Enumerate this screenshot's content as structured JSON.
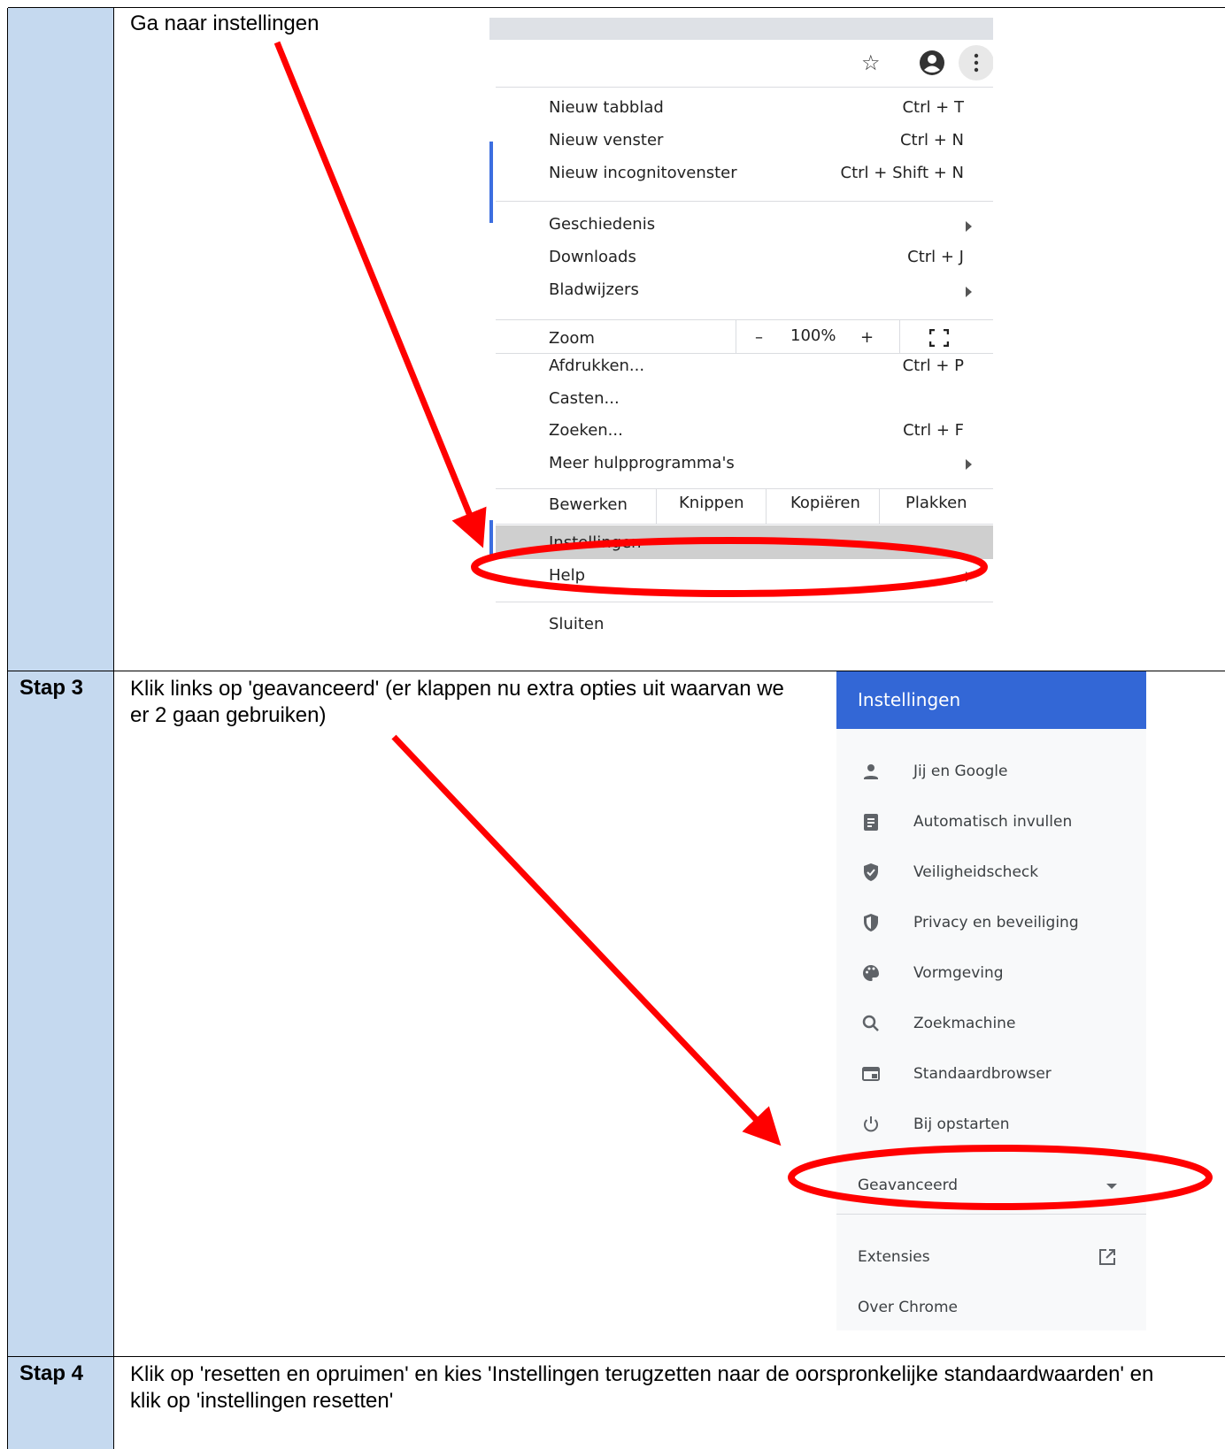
{
  "rows": [
    {
      "step": "",
      "instruction": "Ga naar instellingen"
    },
    {
      "step": "Stap 3",
      "instruction": "Klik links op 'geavanceerd' (er klappen nu extra opties uit waarvan we er 2 gaan gebruiken)"
    },
    {
      "step": "Stap 4",
      "instruction": "Klik op 'resetten en opruimen' en kies 'Instellingen terugzetten naar de oorspronkelijke standaardwaarden' en klik op 'instellingen resetten'"
    }
  ],
  "chrome_menu": {
    "toolbar_icons": [
      "star-icon",
      "account-icon",
      "more-vert-icon"
    ],
    "items": [
      {
        "label": "Nieuw tabblad",
        "shortcut": "Ctrl + T"
      },
      {
        "label": "Nieuw venster",
        "shortcut": "Ctrl + N"
      },
      {
        "label": "Nieuw incognitovenster",
        "shortcut": "Ctrl + Shift + N"
      },
      {
        "label": "Geschiedenis",
        "shortcut": ""
      },
      {
        "label": "Downloads",
        "shortcut": "Ctrl + J"
      },
      {
        "label": "Bladwijzers",
        "shortcut": ""
      },
      {
        "label": "Afdrukken...",
        "shortcut": "Ctrl + P"
      },
      {
        "label": "Casten...",
        "shortcut": ""
      },
      {
        "label": "Zoeken...",
        "shortcut": "Ctrl + F"
      },
      {
        "label": "Meer hulpprogramma's",
        "shortcut": ""
      },
      {
        "label": "Instellingen",
        "shortcut": ""
      },
      {
        "label": "Help",
        "shortcut": ""
      },
      {
        "label": "Sluiten",
        "shortcut": ""
      }
    ],
    "zoom": {
      "label": "Zoom",
      "minus": "–",
      "value": "100%",
      "plus": "+"
    },
    "edit": {
      "label": "Bewerken",
      "cut": "Knippen",
      "copy": "Kopiëren",
      "paste": "Plakken"
    }
  },
  "settings_panel": {
    "title": "Instellingen",
    "items": [
      {
        "label": "Jij en Google",
        "icon": "person-icon"
      },
      {
        "label": "Automatisch invullen",
        "icon": "clipboard-icon"
      },
      {
        "label": "Veiligheidscheck",
        "icon": "shield-check-icon"
      },
      {
        "label": "Privacy en beveiliging",
        "icon": "shield-half-icon"
      },
      {
        "label": "Vormgeving",
        "icon": "palette-icon"
      },
      {
        "label": "Zoekmachine",
        "icon": "search-icon"
      },
      {
        "label": "Standaardbrowser",
        "icon": "browser-icon"
      },
      {
        "label": "Bij opstarten",
        "icon": "power-icon"
      }
    ],
    "advanced": "Geavanceerd",
    "extensions": "Extensies",
    "about": "Over Chrome"
  },
  "colors": {
    "step_column": "#c5d9ef",
    "annotation": "#ff0000",
    "settings_header": "#3367d6",
    "menu_highlight": "#cfcfcf"
  }
}
